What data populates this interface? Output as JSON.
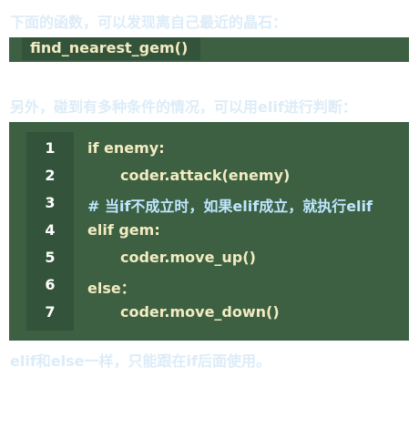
{
  "intro_text": "下面的函数，可以发现离自己最近的晶石：",
  "inline_code": "find_nearest_gem()",
  "else_intro_text": "另外，碰到有多种条件的情况，可以用elif进行判断：",
  "code_lines": [
    {
      "num": "1",
      "text": "if enemy:"
    },
    {
      "num": "2",
      "text": "coder.attack(enemy)"
    },
    {
      "num": "3",
      "text": "# 当if不成立时，如果elif成立，就执行elif"
    },
    {
      "num": "4",
      "text": "elif gem:"
    },
    {
      "num": "5",
      "text": "coder.move_up()"
    },
    {
      "num": "6",
      "text": "else："
    },
    {
      "num": "7",
      "text": "coder.move_down()"
    }
  ],
  "footer_text": "elif和else一样，只能跟在if后面使用。",
  "colors": {
    "note_text": "#dcecf8",
    "code_bg": "#3c6041",
    "gutter_bg": "#33543a",
    "code_text": "#f3ebc2",
    "comment_text": "#bfe6ff",
    "line_number": "#ffffff"
  }
}
